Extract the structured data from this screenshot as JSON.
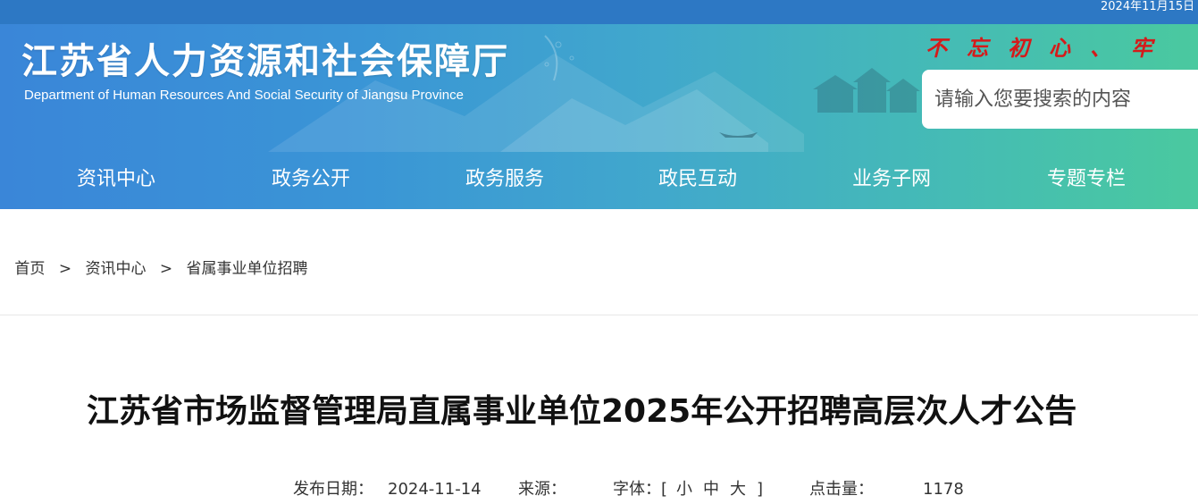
{
  "header": {
    "date": "2024年11月15日",
    "site_title": "江苏省人力资源和社会保障厅",
    "site_subtitle": "Department of Human Resources And Social Security of Jiangsu Province",
    "slogan": "不忘初心、牢",
    "search_placeholder": "请输入您要搜索的内容",
    "colors": {
      "gradient_start": "#3a86d8",
      "gradient_end": "#4ac99f",
      "slogan": "#d51a1a"
    }
  },
  "nav": {
    "items": [
      {
        "label": "资讯中心"
      },
      {
        "label": "政务公开"
      },
      {
        "label": "政务服务"
      },
      {
        "label": "政民互动"
      },
      {
        "label": "业务子网"
      },
      {
        "label": "专题专栏"
      }
    ]
  },
  "breadcrumb": {
    "prefix": "：",
    "items": [
      "首页",
      "资讯中心",
      "省属事业单位招聘"
    ],
    "separator": ">"
  },
  "article": {
    "title": "江苏省市场监督管理局直属事业单位2025年公开招聘高层次人才公告",
    "meta": {
      "publish_label": "发布日期：",
      "publish_date": "2024-11-14",
      "source_label": "来源：",
      "source_value": "",
      "font_label": "字体：",
      "font_open": "[",
      "font_small": "小",
      "font_medium": "中",
      "font_large": "大",
      "font_close": "]",
      "clicks_label": "点击量：",
      "clicks_value": "1178"
    }
  }
}
